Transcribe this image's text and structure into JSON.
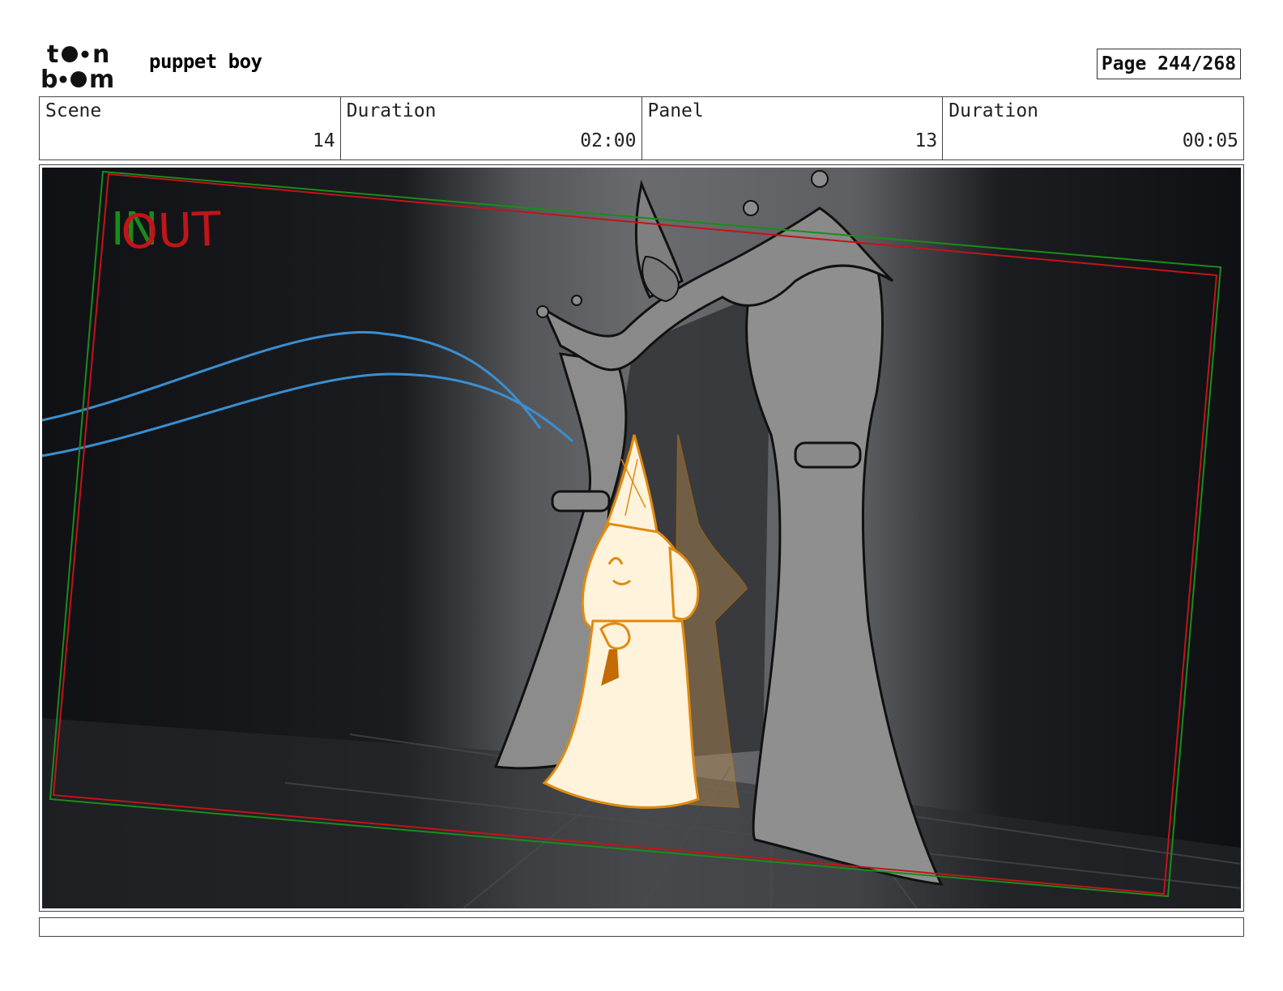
{
  "header": {
    "logo_text": "toon boom",
    "project_title": "puppet boy",
    "page_label": "Page 244/268"
  },
  "info": {
    "scene_label": "Scene",
    "scene_value": "14",
    "scene_duration_label": "Duration",
    "scene_duration_value": "02:00",
    "panel_label": "Panel",
    "panel_value": "13",
    "panel_duration_label": "Duration",
    "panel_duration_value": "00:05"
  },
  "panel": {
    "camera_in_label": "IN",
    "camera_out_label": "OUT",
    "colors": {
      "in_frame": "#1a8c1a",
      "out_frame": "#c0151a",
      "motion_path": "#3a8fd0",
      "character_line": "#e08a10",
      "character_fill": "#fff3dc",
      "curtain": "#8c8c8c"
    }
  },
  "notes": {
    "text": ""
  }
}
